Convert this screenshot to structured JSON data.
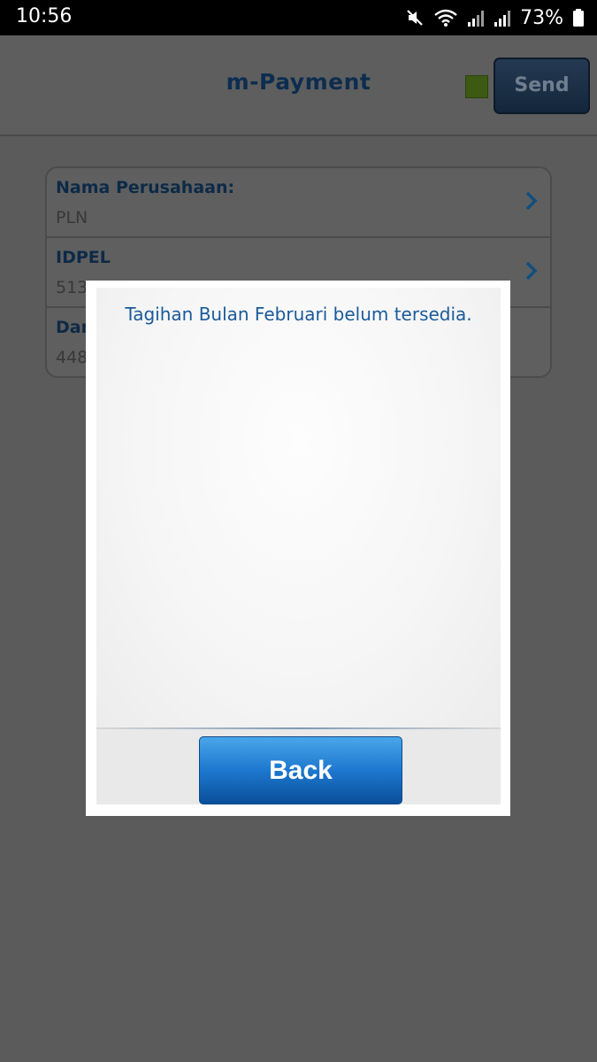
{
  "status_bar": {
    "time": "10:56",
    "battery_percent": "73%",
    "icons": [
      "mute-icon",
      "wifi-icon",
      "signal-icon",
      "signal-icon",
      "battery-icon"
    ]
  },
  "app": {
    "title": "m-Payment",
    "send_label": "Send",
    "indicator_color": "#3c5a12",
    "form": {
      "rows": [
        {
          "label": "Nama Perusahaan:",
          "value": "PLN"
        },
        {
          "label": "IDPEL",
          "value": "513"
        },
        {
          "label": "Dar",
          "value": "448"
        }
      ]
    }
  },
  "dialog": {
    "message": "Tagihan Bulan Februari belum tersedia.",
    "back_label": "Back",
    "accent_color": "#1d78cf"
  }
}
